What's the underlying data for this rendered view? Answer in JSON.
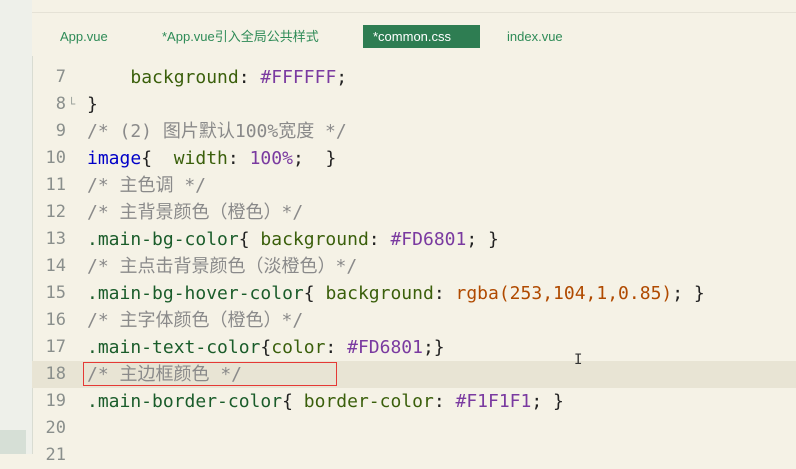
{
  "tabs": [
    "App.vue",
    "*App.vue引入全局公共样式",
    "*common.css",
    "index.vue"
  ],
  "lines": [
    {
      "no": "7",
      "parts": [
        [
          "plain",
          "    "
        ],
        [
          "prop",
          "background"
        ],
        [
          "plain",
          ": "
        ],
        [
          "val",
          "#FFFFFF"
        ],
        [
          "plain",
          ";"
        ]
      ]
    },
    {
      "no": "8",
      "parts": [
        [
          "plain",
          "}"
        ]
      ]
    },
    {
      "no": "9",
      "parts": [
        [
          "cm",
          "/* (2) 图片默认100%宽度 */"
        ]
      ]
    },
    {
      "no": "10",
      "parts": [
        [
          "kw",
          "image"
        ],
        [
          "plain",
          "{  "
        ],
        [
          "prop",
          "width"
        ],
        [
          "plain",
          ": "
        ],
        [
          "val",
          "100%"
        ],
        [
          "plain",
          ";  }"
        ]
      ]
    },
    {
      "no": "11",
      "parts": [
        [
          "cm",
          "/* 主色调 */"
        ]
      ]
    },
    {
      "no": "12",
      "parts": [
        [
          "cm",
          "/* 主背景颜色（橙色）*/"
        ]
      ]
    },
    {
      "no": "13",
      "parts": [
        [
          "sel",
          ".main-bg-color"
        ],
        [
          "plain",
          "{ "
        ],
        [
          "prop",
          "background"
        ],
        [
          "plain",
          ": "
        ],
        [
          "val",
          "#FD6801"
        ],
        [
          "plain",
          "; }"
        ]
      ]
    },
    {
      "no": "14",
      "parts": [
        [
          "cm",
          "/* 主点击背景颜色（淡橙色）*/"
        ]
      ]
    },
    {
      "no": "15",
      "parts": [
        [
          "sel",
          ".main-bg-hover-color"
        ],
        [
          "plain",
          "{ "
        ],
        [
          "prop",
          "background"
        ],
        [
          "plain",
          ": "
        ],
        [
          "fn",
          "rgba(253,104,1,0.85)"
        ],
        [
          "plain",
          "; }"
        ]
      ]
    },
    {
      "no": "16",
      "parts": [
        [
          "cm",
          "/* 主字体颜色（橙色）*/"
        ]
      ]
    },
    {
      "no": "17",
      "parts": [
        [
          "sel",
          ".main-text-color"
        ],
        [
          "plain",
          "{"
        ],
        [
          "prop",
          "color"
        ],
        [
          "plain",
          ": "
        ],
        [
          "val",
          "#FD6801"
        ],
        [
          "plain",
          ";}"
        ]
      ]
    },
    {
      "no": "18",
      "parts": [
        [
          "cm",
          "/* 主边框颜色 */"
        ]
      ]
    },
    {
      "no": "19",
      "parts": [
        [
          "sel",
          ".main-border-color"
        ],
        [
          "plain",
          "{ "
        ],
        [
          "prop",
          "border-color"
        ],
        [
          "plain",
          ": "
        ],
        [
          "val",
          "#F1F1F1"
        ],
        [
          "plain",
          "; }"
        ]
      ]
    },
    {
      "no": "20",
      "parts": []
    },
    {
      "no": "21",
      "parts": []
    }
  ]
}
